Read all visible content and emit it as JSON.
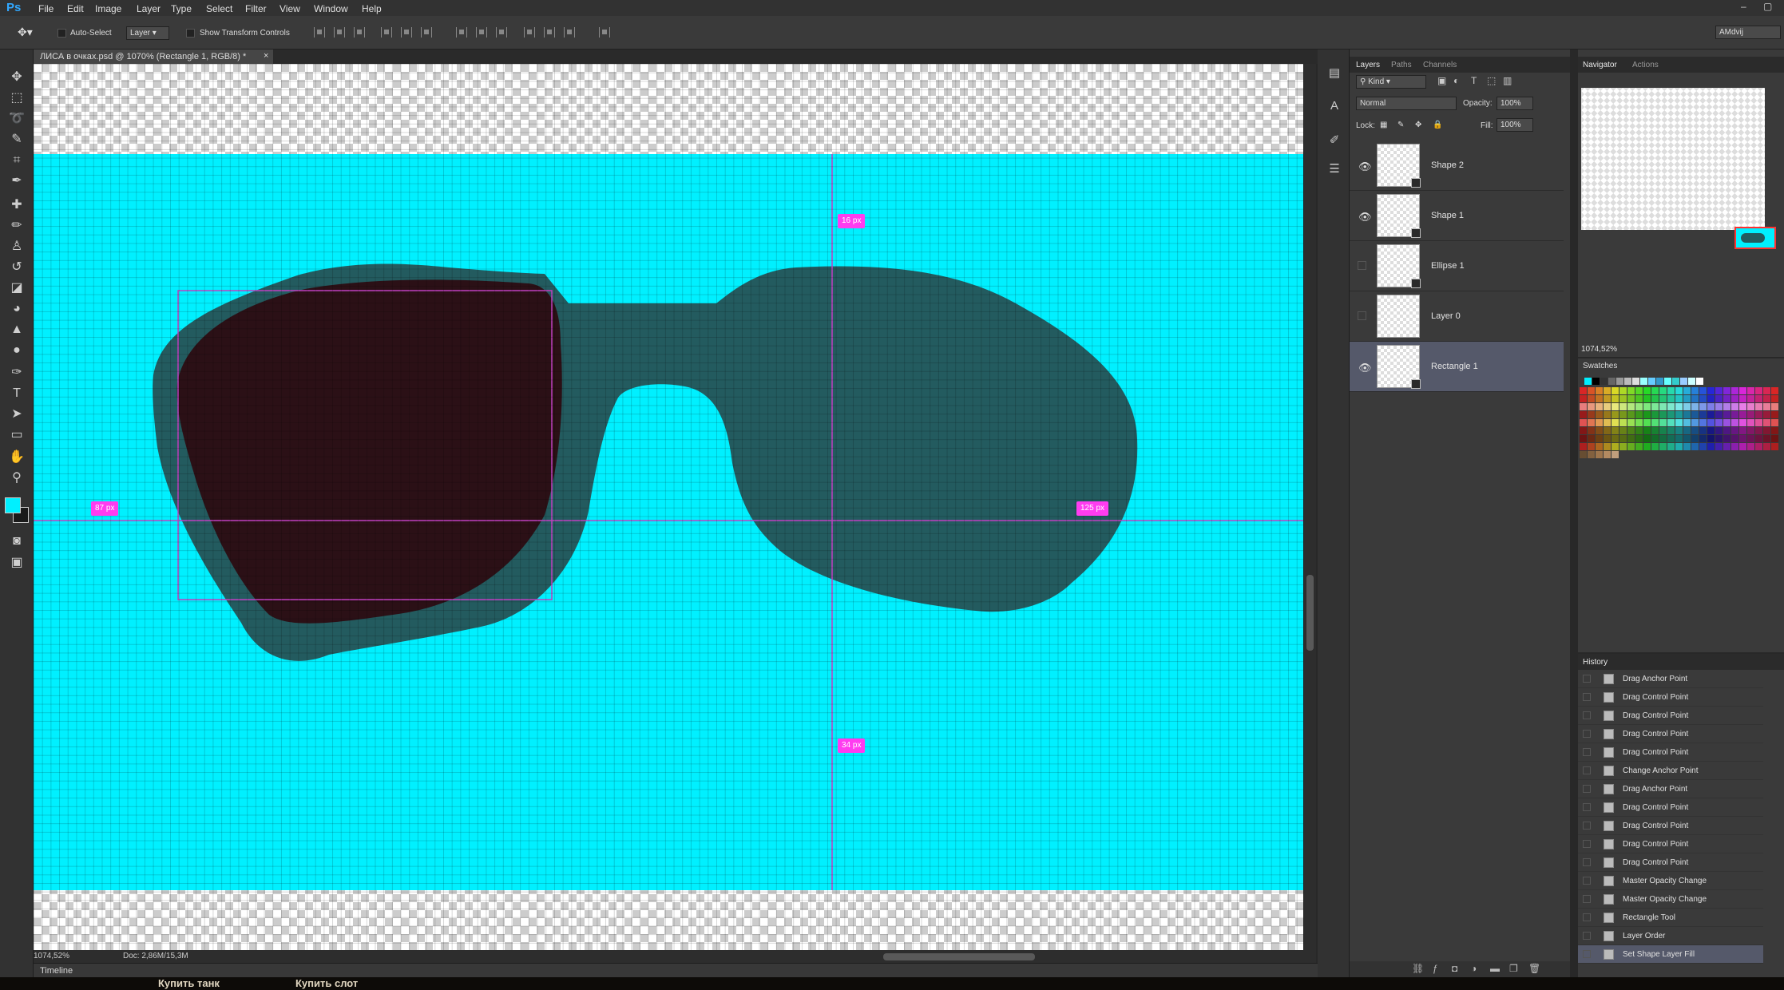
{
  "app": {
    "logo": "Ps"
  },
  "menu": [
    "File",
    "Edit",
    "Image",
    "Layer",
    "Type",
    "Select",
    "Filter",
    "View",
    "Window",
    "Help"
  ],
  "workspace": "AMdvij",
  "window_controls": [
    "–",
    "▢"
  ],
  "options": {
    "auto_select_label": "Auto-Select",
    "auto_select_target": "Layer",
    "show_transform_label": "Show Transform Controls"
  },
  "document": {
    "tab_title": "ЛИСА в очках.psd @ 1070% (Rectangle 1, RGB/8) *",
    "close": "×",
    "zoom": "1074,52%",
    "doc_info": "Doc: 2,86M/15,3M",
    "canvas_fill": "#00f0ff",
    "glasses_frame": "#235b5f",
    "lens_dark": "#2b1016",
    "guide_color": "#c040c0"
  },
  "measurements": [
    "16 px",
    "87 px",
    "125 px",
    "34 px"
  ],
  "timeline_label": "Timeline",
  "taskbar_items": [
    "Купить танк",
    "Купить слот"
  ],
  "layers_panel": {
    "tabs": [
      "Layers",
      "Paths",
      "Channels"
    ],
    "filter_label": "Kind",
    "blend_mode": "Normal",
    "opacity_label": "Opacity:",
    "opacity_value": "100%",
    "lock_label": "Lock:",
    "fill_label": "Fill:",
    "fill_value": "100%",
    "layers": [
      {
        "name": "Shape 2",
        "visible": true,
        "selected": false
      },
      {
        "name": "Shape 1",
        "visible": true,
        "selected": false
      },
      {
        "name": "Ellipse 1",
        "visible": false,
        "selected": false
      },
      {
        "name": "Layer 0",
        "visible": false,
        "selected": false
      },
      {
        "name": "Rectangle 1",
        "visible": true,
        "selected": true
      }
    ]
  },
  "navigator": {
    "tabs": [
      "Navigator",
      "Actions"
    ],
    "zoom": "1074,52%"
  },
  "swatches": {
    "title": "Swatches"
  },
  "history": {
    "title": "History",
    "items": [
      "Drag Anchor Point",
      "Drag Control Point",
      "Drag Control Point",
      "Drag Control Point",
      "Drag Control Point",
      "Change Anchor Point",
      "Drag Anchor Point",
      "Drag Control Point",
      "Drag Control Point",
      "Drag Control Point",
      "Drag Control Point",
      "Master Opacity Change",
      "Master Opacity Change",
      "Rectangle Tool",
      "Layer Order",
      "Set Shape Layer Fill"
    ],
    "selected_index": 15
  }
}
